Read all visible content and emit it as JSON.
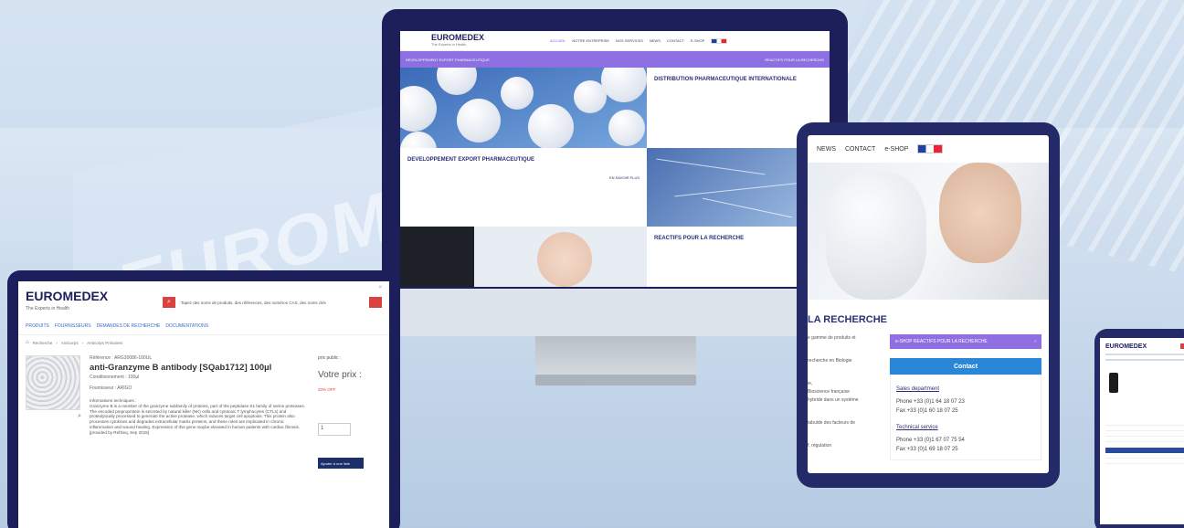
{
  "background": {
    "logo_text": "EUROMEDEX"
  },
  "desktop": {
    "logo": "EUROMEDEX",
    "tagline": "The Experts in Health",
    "nav": [
      "ACCUEIL",
      "NOTRE ENTREPRISE",
      "NOS SERVICES",
      "NEWS",
      "CONTACT",
      "E-SHOP"
    ],
    "band_left": "DEVELOPPEMENT EXPORT PHARMACEUTIQUE",
    "band_right": "REACTIFS POUR LA RECHERCHE",
    "distribution": {
      "title": "DISTRIBUTION PHARMACEUTIQUE INTERNATIONALE"
    },
    "export": {
      "title": "DEVELOPPEMENT EXPORT PHARMACEUTIQUE",
      "link": "EN SAVOIR PLUS"
    },
    "reactifs": {
      "title": "REACTIFS POUR LA RECHERCHE"
    }
  },
  "tablet": {
    "nav": [
      "NEWS",
      "CONTACT",
      "e-SHOP"
    ],
    "title": "LA RECHERCHE",
    "left_texts": [
      "e gamme de produits et",
      "recherche en Biologie",
      "ie,",
      "Bioscience française",
      "hybride dans un système",
      "tabulde des facteurs de",
      "f, régulation"
    ],
    "eshop_button": "e-SHOP REACTIFS POUR LA RECHERCHE",
    "contact_button": "Contact",
    "sales_label": "Sales department",
    "sales_phone": "Phone +33 (0)1 64 18 07 23",
    "sales_fax": "Fax      +33 (0)1 60 18 07 25",
    "tech_label": "Technical service",
    "tech_phone": "Phone +33 (0)1 67 07 75 54",
    "tech_fax": "Fax      +33 (0)1 69 18 07 25"
  },
  "laptop": {
    "logo": "EUROMEDEX",
    "tagline": "The Experts in Health",
    "search_placeholder": "Tapez des noms de produits, des références, des numéros CAS, des noms clés",
    "menu": [
      "PRODUITS",
      "FOURNISSEURS",
      "DEMANDES DE RECHERCHE",
      "DOCUMENTATIONS"
    ],
    "breadcrumb": [
      "Recherche",
      "Anticorps",
      "Anticorps Primaires"
    ],
    "reference": "Référence : ARG30086-100UL",
    "product_name": "anti-Granzyme B antibody [SQab1712] 100µl",
    "packaging": "Conditionnement : 100µl",
    "supplier": "Fournisseur : ARIGO",
    "info_label": "Informations techniques :",
    "description": "Granzyme B is a member of the granzyme subfamily of proteins, part of the peptidase S1 family of serine proteases. The encoded preproprotein is secreted by natural killer (NK) cells and cytotoxic T lymphocytes (CTLs) and proteolytically processed to generate the active protease, which induces target cell apoptosis. This protein also processes cytokines and degrades extracellular matrix proteins, and these roles are implicated in chronic inflammation and wound healing. Expression of this gene maybe elevated in human patients with cardiac fibrosis. [provided by RefSeq, Sep 2015]",
    "public_price_label": "prix public :",
    "your_price_label": "Votre prix :",
    "discount": "20% OFF",
    "qty": "1",
    "add_button": "Ajouter à une liste",
    "close": "×"
  },
  "phone": {
    "logo": "EUROMEDEX"
  }
}
